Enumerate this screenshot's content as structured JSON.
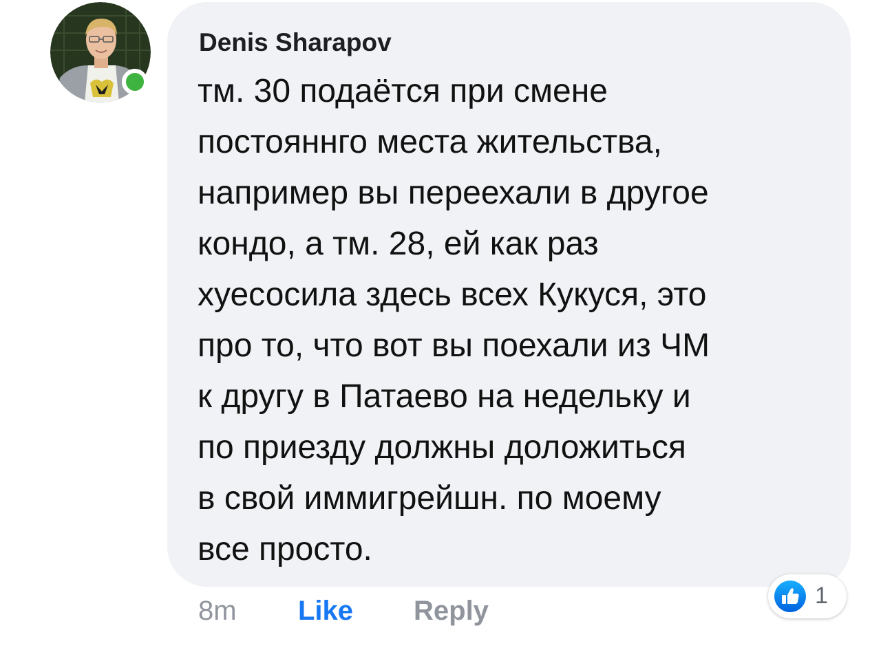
{
  "comment": {
    "author": "Denis Sharapov",
    "text": "тм. 30 подаётся при смене\nпостояннго места жительства,\nнапример вы переехали в другое\nкондо, а  тм. 28, ей как раз\nхуесосила здесь всех Кукуся, это\nпро то, что вот вы поехали из ЧМ\nк другу в Патаево на недельку и\nпо приезду должны доложиться\nв свой иммигрейшн. по моему\nвсе просто.",
    "time": "8m",
    "like_label": "Like",
    "reply_label": "Reply",
    "reaction_count": "1",
    "reaction_icon": "thumbs-up-icon",
    "online_status": "online"
  },
  "colors": {
    "bubble": "#f0f2f5",
    "like": "#1877f2",
    "online": "#3fb33f",
    "muted": "#90949c"
  }
}
